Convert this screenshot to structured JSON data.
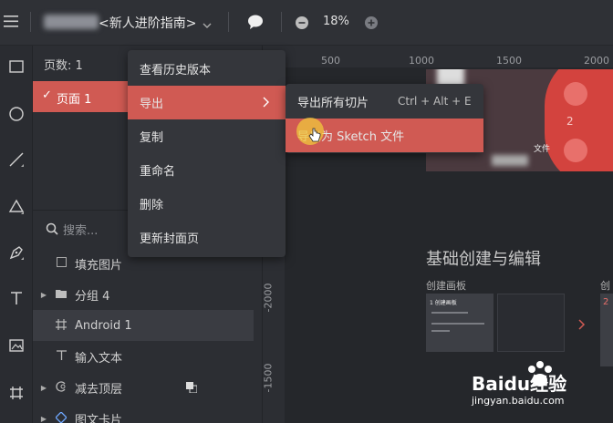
{
  "topbar": {
    "menu_icon": "hamburger-icon",
    "file_title": "<新人进阶指南>",
    "comment_icon": "comment-bubble-icon",
    "zoom_out_icon": "minus-circle-icon",
    "zoom_level": "18%",
    "zoom_in_icon": "plus-circle-icon"
  },
  "toolbar": {
    "tools": [
      "rectangle-icon",
      "ellipse-icon",
      "line-icon",
      "triangle-icon",
      "pen-icon",
      "text-icon",
      "image-icon",
      "artboard-icon"
    ]
  },
  "pages": {
    "count_label": "页数: 1",
    "items": [
      {
        "label": "页面 1",
        "selected": true
      }
    ]
  },
  "context_menu": {
    "items": [
      "查看历史版本",
      "导出",
      "复制",
      "重命名",
      "删除",
      "更新封面页"
    ]
  },
  "submenu": {
    "items": [
      {
        "label": "导出所有切片",
        "shortcut": "Ctrl + Alt + E"
      },
      {
        "label": "导出为 Sketch 文件",
        "shortcut": ""
      }
    ]
  },
  "search": {
    "placeholder": "搜索..."
  },
  "layers": [
    {
      "label": "填充图片",
      "icon": "square-outline-icon"
    },
    {
      "label": "分组 4",
      "icon": "folder-icon"
    },
    {
      "label": "Android 1",
      "icon": "artboard-icon"
    },
    {
      "label": "输入文本",
      "icon": "text-icon"
    },
    {
      "label": "减去顶层",
      "icon": "subtract-icon"
    },
    {
      "label": "图文卡片",
      "icon": "component-icon"
    }
  ],
  "ruler": {
    "top_ticks": [
      "500",
      "1000",
      "1500",
      "2000"
    ],
    "left_ticks": [
      "-2000",
      "-1500"
    ]
  },
  "canvas": {
    "section_title": "基础创建与编辑",
    "card_label_1": "创建画板",
    "card_label_2": "创",
    "card_heading": "1 创建画板",
    "card_num": "2",
    "card_num_2": "2",
    "doc_label": "文件"
  },
  "watermark": {
    "brand": "Baidu经验",
    "url": "jingyan.baidu.com"
  },
  "colors": {
    "accent": "#c9574f",
    "selection": "#d05a53"
  }
}
